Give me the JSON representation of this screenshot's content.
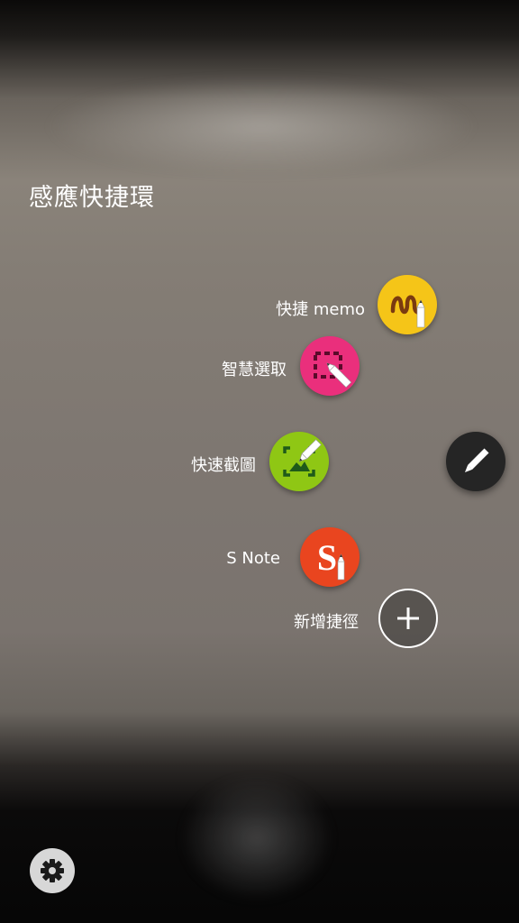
{
  "title": "感應快捷環",
  "items": [
    {
      "label": "快捷 memo",
      "icon": "action-memo-icon",
      "color": "#f5c518"
    },
    {
      "label": "智慧選取",
      "icon": "smart-select-icon",
      "color": "#ea2f7c"
    },
    {
      "label": "快速截圖",
      "icon": "screen-write-icon",
      "color": "#8fc714"
    },
    {
      "label": "S Note",
      "icon": "s-note-icon",
      "color": "#e9451f",
      "glyph": "S"
    },
    {
      "label": "新增捷徑",
      "icon": "plus-icon"
    }
  ],
  "fab_icon": "pen-icon",
  "settings_icon": "gear-icon"
}
